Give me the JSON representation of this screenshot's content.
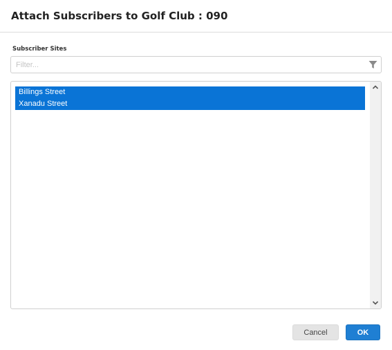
{
  "dialog": {
    "title": "Attach Subscribers to Golf Club : 090"
  },
  "subscriber_sites": {
    "label": "Subscriber Sites",
    "filter_placeholder": "Filter...",
    "filter_value": "",
    "filter_icon": "filter-icon",
    "items": [
      {
        "label": "Billings Street",
        "selected": true
      },
      {
        "label": "Xanadu Street",
        "selected": true
      }
    ]
  },
  "buttons": {
    "cancel_label": "Cancel",
    "ok_label": "OK"
  },
  "colors": {
    "selection": "#0a74d6",
    "primary_button": "#1f7fd3",
    "secondary_button": "#e4e4e4"
  }
}
